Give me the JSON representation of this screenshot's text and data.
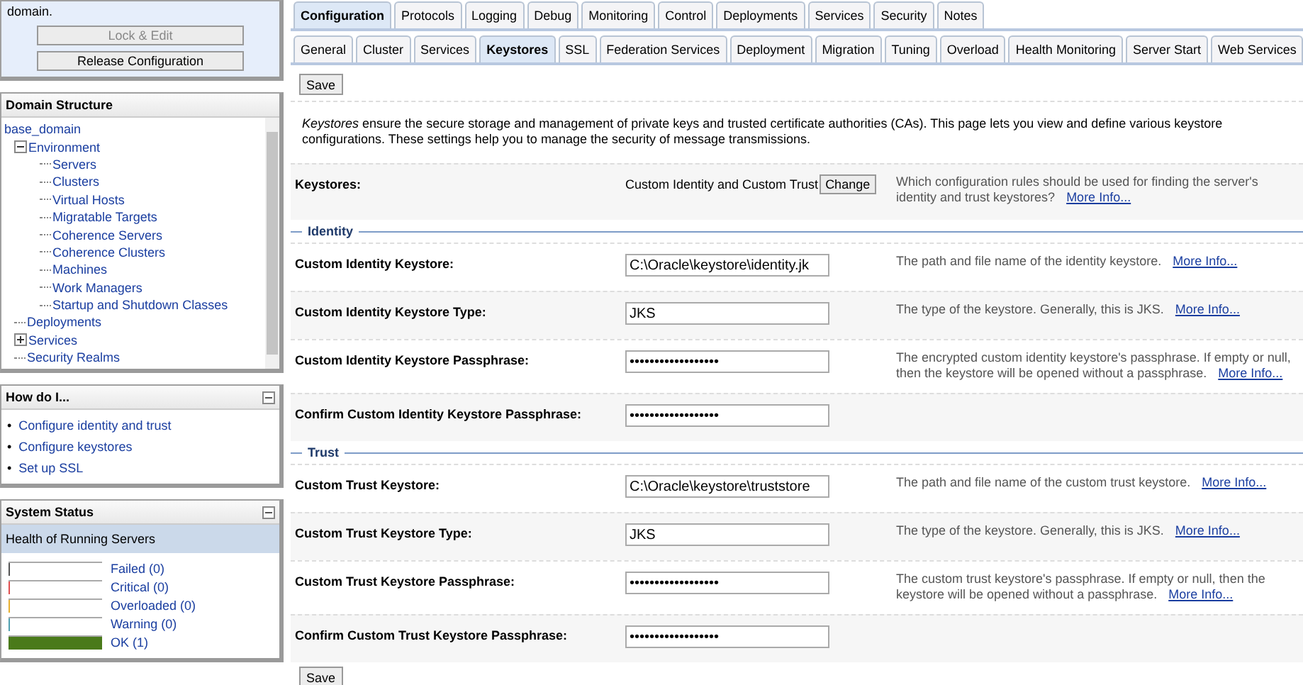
{
  "change_center": {
    "message": "domain.",
    "buttons": [
      {
        "label": "Lock & Edit",
        "disabled": true
      },
      {
        "label": "Release Configuration",
        "disabled": false
      }
    ]
  },
  "domain_structure": {
    "title": "Domain Structure",
    "tree": [
      {
        "label": "base_domain",
        "children": [
          {
            "label": "Environment",
            "expanded": true,
            "children": [
              {
                "label": "Servers"
              },
              {
                "label": "Clusters"
              },
              {
                "label": "Virtual Hosts"
              },
              {
                "label": "Migratable Targets"
              },
              {
                "label": "Coherence Servers"
              },
              {
                "label": "Coherence Clusters"
              },
              {
                "label": "Machines"
              },
              {
                "label": "Work Managers"
              },
              {
                "label": "Startup and Shutdown Classes"
              }
            ]
          },
          {
            "label": "Deployments"
          },
          {
            "label": "Services",
            "expanded": false
          },
          {
            "label": "Security Realms"
          }
        ]
      }
    ]
  },
  "how_do_i": {
    "title": "How do I...",
    "links": [
      {
        "marker": "•",
        "label": "Configure identity and trust"
      },
      {
        "marker": "•",
        "label": "Configure keystores"
      },
      {
        "marker": "•",
        "label": "Set up SSL"
      }
    ]
  },
  "system_status": {
    "title": "System Status",
    "subtitle": "Health of Running Servers",
    "items": [
      {
        "label": "Failed (0)",
        "color": "#555555",
        "level": 0
      },
      {
        "label": "Critical (0)",
        "color": "#e05050",
        "level": 0
      },
      {
        "label": "Overloaded (0)",
        "color": "#e8b030",
        "level": 0
      },
      {
        "label": "Warning (0)",
        "color": "#50a0b0",
        "level": 0
      },
      {
        "label": "OK (1)",
        "color": "#4a7a1a",
        "level": 1
      }
    ]
  },
  "tabs": [
    {
      "label": "Configuration",
      "selected": true
    },
    {
      "label": "Protocols",
      "selected": false
    },
    {
      "label": "Logging",
      "selected": false
    },
    {
      "label": "Debug",
      "selected": false
    },
    {
      "label": "Monitoring",
      "selected": false
    },
    {
      "label": "Control",
      "selected": false
    },
    {
      "label": "Deployments",
      "selected": false
    },
    {
      "label": "Services",
      "selected": false
    },
    {
      "label": "Security",
      "selected": false
    },
    {
      "label": "Notes",
      "selected": false
    }
  ],
  "subtabs": [
    {
      "label": "General",
      "selected": false
    },
    {
      "label": "Cluster",
      "selected": false
    },
    {
      "label": "Services",
      "selected": false
    },
    {
      "label": "Keystores",
      "selected": true
    },
    {
      "label": "SSL",
      "selected": false
    },
    {
      "label": "Federation Services",
      "selected": false
    },
    {
      "label": "Deployment",
      "selected": false
    },
    {
      "label": "Migration",
      "selected": false
    },
    {
      "label": "Tuning",
      "selected": false
    },
    {
      "label": "Overload",
      "selected": false
    },
    {
      "label": "Health Monitoring",
      "selected": false
    },
    {
      "label": "Server Start",
      "selected": false
    },
    {
      "label": "Web Services",
      "selected": false
    }
  ],
  "save_buttons": [
    "Save",
    "Save"
  ],
  "description": "*Keystores* ensure the secure storage and management of private keys and trusted certificate authorities (CAs). This page lets you view and define various keystore configurations. These settings help you to manage the security of message transmissions.",
  "keystores": {
    "label": "Keystores:",
    "value": "Custom Identity and Custom Trust",
    "button": "Change",
    "help": "Which configuration rules should be used for finding the server's identity and trust keystores?",
    "more_info": "More Info..."
  },
  "sections": [
    {
      "title": "Identity",
      "rows": [
        {
          "label": "Custom Identity Keystore:",
          "value": "C:\\Oracle\\keystore\\identity.jk",
          "help": "The path and file name of the identity keystore.",
          "more_info": "More Info..."
        },
        {
          "label": "Custom Identity Keystore Type:",
          "value": "JKS",
          "help": "The type of the keystore. Generally, this is JKS.",
          "more_info": "More Info..."
        },
        {
          "label": "Custom Identity Keystore Passphrase:",
          "value": "••••••••••••••••••",
          "help": "The encrypted custom identity keystore's passphrase. If empty or null, then the keystore will be opened without a passphrase.",
          "more_info": "More Info..."
        },
        {
          "label": "Confirm Custom Identity Keystore Passphrase:",
          "value": "••••••••••••••••••"
        }
      ]
    },
    {
      "title": "Trust",
      "rows": [
        {
          "label": "Custom Trust Keystore:",
          "value": "C:\\Oracle\\keystore\\truststore",
          "help": "The path and file name of the custom trust keystore.",
          "more_info": "More Info..."
        },
        {
          "label": "Custom Trust Keystore Type:",
          "value": "JKS",
          "help": "The type of the keystore. Generally, this is JKS.",
          "more_info": "More Info..."
        },
        {
          "label": "Custom Trust Keystore Passphrase:",
          "value": "••••••••••••••••••",
          "help": "The custom trust keystore's passphrase. If empty or null, then the keystore will be opened without a passphrase.",
          "more_info": "More Info..."
        },
        {
          "label": "Confirm Custom Trust Keystore Passphrase:",
          "value": "••••••••••••••••••"
        }
      ]
    }
  ]
}
